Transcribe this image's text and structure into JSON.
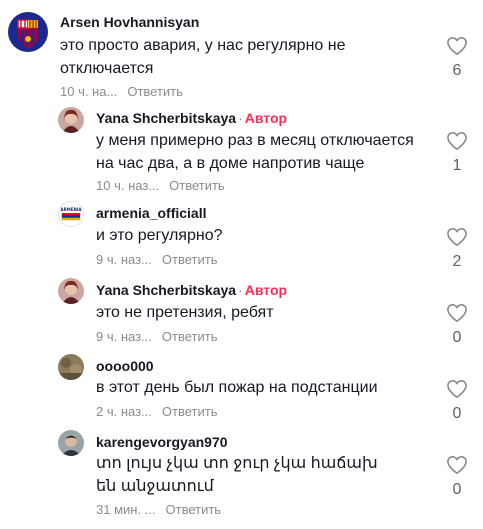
{
  "comments": [
    {
      "author": "Arsen Hovhannisyan",
      "badge": "",
      "text": "это просто авария, у нас регулярно не отключается",
      "time": "10 ч. на...",
      "reply": "Ответить",
      "likes": "6",
      "avatar": "fc-barcelona-crest"
    },
    {
      "author": "Yana Shcherbitskaya",
      "badge": "Автор",
      "text": "у меня примерно раз в месяц отключается на час два, а в доме напротив чаще",
      "time": "10 ч. наз...",
      "reply": "Ответить",
      "likes": "1",
      "avatar": "woman-portrait"
    },
    {
      "author": "armenia_officiall",
      "badge": "",
      "text": "и это регулярно?",
      "time": "9 ч. наз...",
      "reply": "Ответить",
      "likes": "2",
      "avatar": "armenia-flag-logo"
    },
    {
      "author": "Yana Shcherbitskaya",
      "badge": "Автор",
      "text": "это не претензия, ребят",
      "time": "9 ч. наз...",
      "reply": "Ответить",
      "likes": "0",
      "avatar": "woman-portrait"
    },
    {
      "author": "oooo000",
      "badge": "",
      "text": "в этот день был пожар на подстанции",
      "time": "2 ч. наз...",
      "reply": "Ответить",
      "likes": "0",
      "avatar": "brown-photo"
    },
    {
      "author": "karengevorgyan970",
      "badge": "",
      "text": "տո լույս չկա տո ջուր չկա հաճախ են անջատում",
      "time": "31 мин. ...",
      "reply": "Ответить",
      "likes": "0",
      "avatar": "man-portrait"
    }
  ],
  "avatar_text": {
    "armenia": "ARMENIA"
  },
  "colors": {
    "accent": "#fe2c55",
    "muted": "#8a8b91",
    "text": "#161823"
  }
}
